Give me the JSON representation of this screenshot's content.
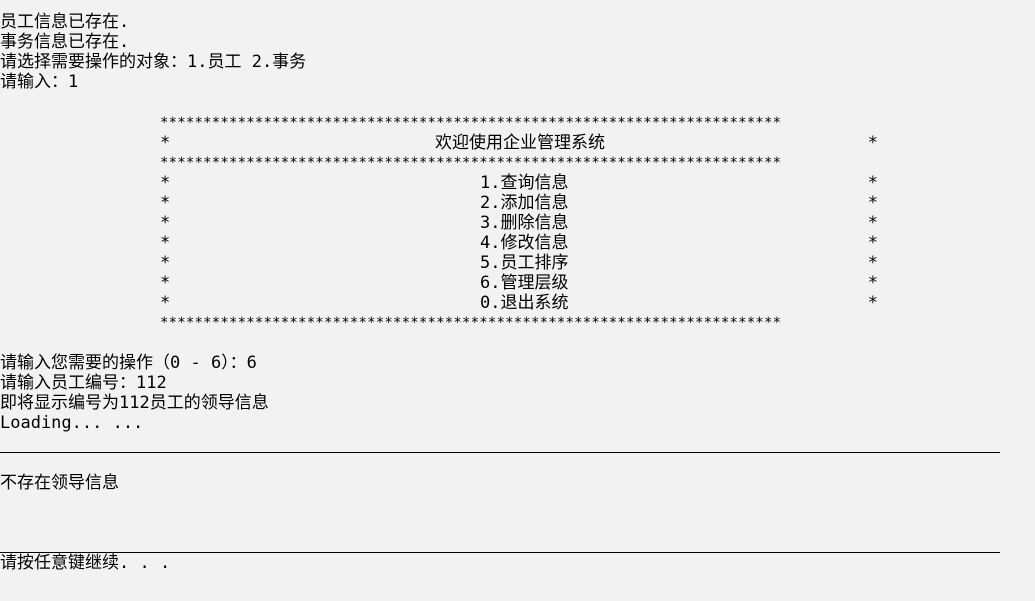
{
  "top_partial_border": "************************************************************************",
  "pre_menu_lines": [
    "员工信息已存在.",
    "事务信息已存在.",
    "请选择需要操作的对象：1.员工 2.事务",
    "请输入：1"
  ],
  "menu": {
    "border": "************************************************************************",
    "edge_char": "*",
    "title": "欢迎使用企业管理系统",
    "items": [
      "1.查询信息",
      "2.添加信息",
      "3.删除信息",
      "4.修改信息",
      "5.员工排序",
      "6.管理层级",
      "0.退出系统"
    ]
  },
  "post_menu_lines": [
    "请输入您需要的操作（0 - 6）：6",
    "请输入员工编号：112",
    "即将显示编号为112员工的领导信息",
    "Loading... ..."
  ],
  "result_text": "不存在领导信息",
  "prompt_text": "请按任意键继续. . ."
}
